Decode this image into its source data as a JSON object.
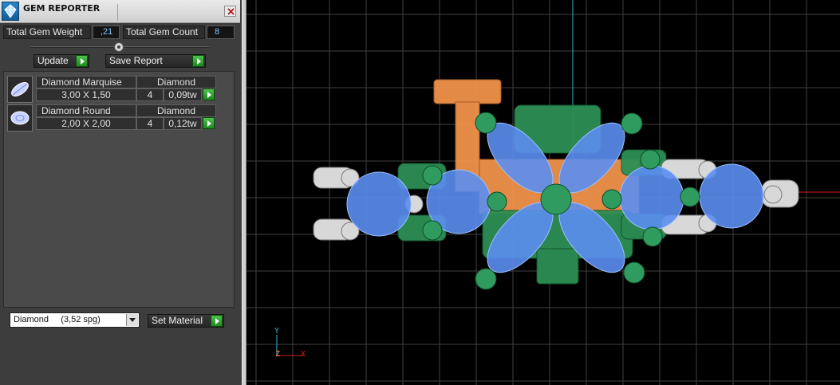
{
  "window": {
    "title": "GEM REPORTER"
  },
  "summary": {
    "total_weight_label": "Total Gem Weight",
    "total_weight_value": ",21",
    "total_count_label": "Total Gem Count",
    "total_count_value": "8"
  },
  "actions": {
    "update_label": "Update",
    "save_report_label": "Save Report"
  },
  "gems": [
    {
      "name": "Diamond Marquise",
      "material": "Diamond",
      "size": "3,00 X 1,50",
      "count": "4",
      "weight": "0,09tw",
      "icon": "marquise-gem-icon"
    },
    {
      "name": "Diamond Round",
      "material": "Diamond",
      "size": "2,00 X 2,00",
      "count": "4",
      "weight": "0,12tw",
      "icon": "round-gem-icon"
    }
  ],
  "material": {
    "selected": "Diamond     (3,52 spg)",
    "set_material_label": "Set Material"
  },
  "viewport": {
    "axis_y_label": "Y",
    "axis_z_label": "Z",
    "axis_x_label": "X",
    "colors": {
      "background": "#000000",
      "grid": "#3f3f3f",
      "y_axis": "#2fb7d3",
      "x_axis": "#d11b1b",
      "gem": "#5b8ef0",
      "prong": "#2a8a55",
      "base": "#f0924a",
      "metal": "#d8d8d8"
    }
  }
}
